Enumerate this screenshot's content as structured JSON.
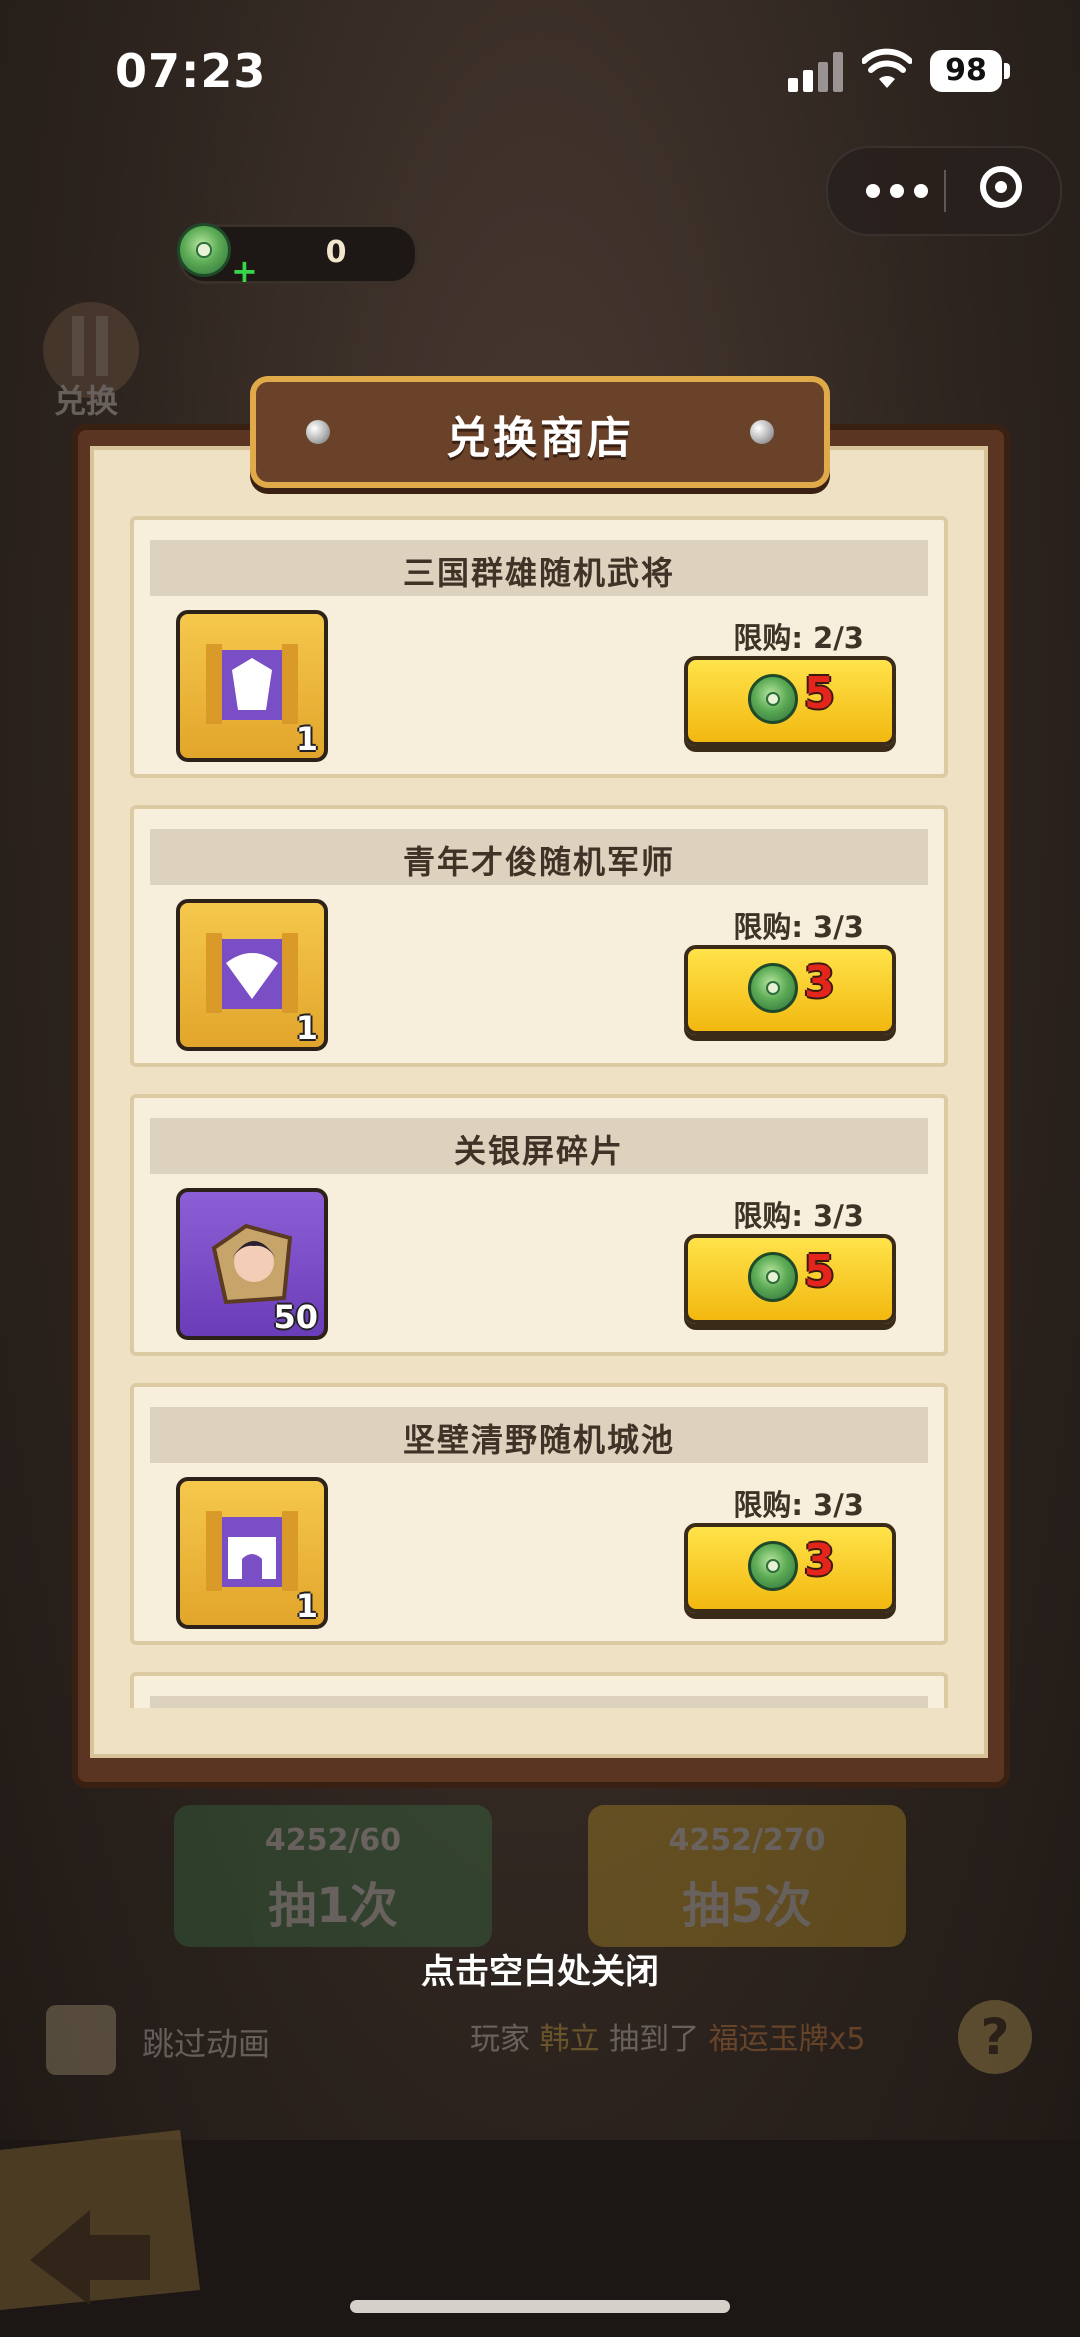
{
  "status_bar": {
    "time": "07:23",
    "battery": "98"
  },
  "currency": {
    "icon": "jade-coin-icon",
    "value": "0"
  },
  "background": {
    "corner_label": "兑换"
  },
  "shop": {
    "title": "兑换商店",
    "items": [
      {
        "name": "三国群雄随机武将",
        "limit": "限购: 2/3",
        "price": "5",
        "quantity": "1",
        "icon": "general-chest-icon",
        "frame": "gold"
      },
      {
        "name": "青年才俊随机军师",
        "limit": "限购: 3/3",
        "price": "3",
        "quantity": "1",
        "icon": "strategist-chest-icon",
        "frame": "gold"
      },
      {
        "name": "关银屏碎片",
        "limit": "限购: 3/3",
        "price": "5",
        "quantity": "50",
        "icon": "hero-fragment-icon",
        "frame": "purple"
      },
      {
        "name": "坚壁清野随机城池",
        "limit": "限购: 3/3",
        "price": "3",
        "quantity": "1",
        "icon": "city-chest-icon",
        "frame": "gold"
      },
      {
        "name": "",
        "limit": "",
        "price": "",
        "quantity": "",
        "icon": "",
        "frame": "gold"
      }
    ]
  },
  "background_ui": {
    "draw_once": {
      "cost": "4252/60",
      "label": "抽1次"
    },
    "draw_five": {
      "cost": "4252/270",
      "label": "抽5次"
    },
    "skip_label": "跳过动画",
    "ticker": {
      "prefix": "玩家",
      "player": "韩立",
      "verb": "抽到了",
      "prize": "福运玉牌x5"
    }
  },
  "close_hint": "点击空白处关闭",
  "colors": {
    "panel_bg": "#efe2c4",
    "buy_button": "#f7c51f",
    "price_text": "#e3251c",
    "banner": "#6a4129"
  }
}
